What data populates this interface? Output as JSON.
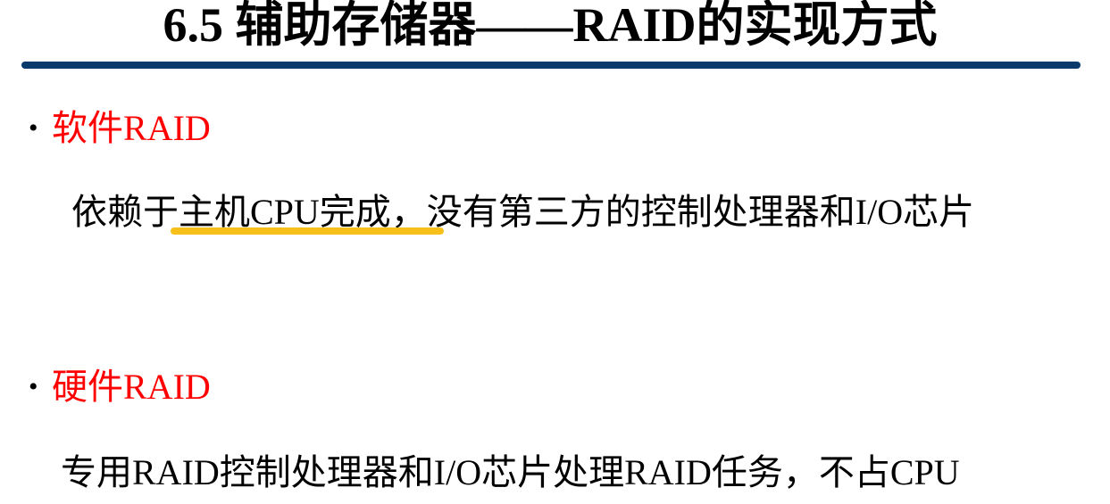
{
  "slide": {
    "title": "6.5 辅助存储器——RAID的实现方式",
    "bullet_symbol": "•"
  },
  "software_raid": {
    "label": "软件RAID",
    "description": "依赖于主机CPU完成，没有第三方的控制处理器和I/O芯片"
  },
  "hardware_raid": {
    "label": "硬件RAID",
    "description": "专用RAID控制处理器和I/O芯片处理RAID任务，不占CPU"
  },
  "colors": {
    "title_rule": "#0a3a6b",
    "bullet_label": "#ff0000",
    "highlight": "#f5b800",
    "text": "#000000"
  }
}
